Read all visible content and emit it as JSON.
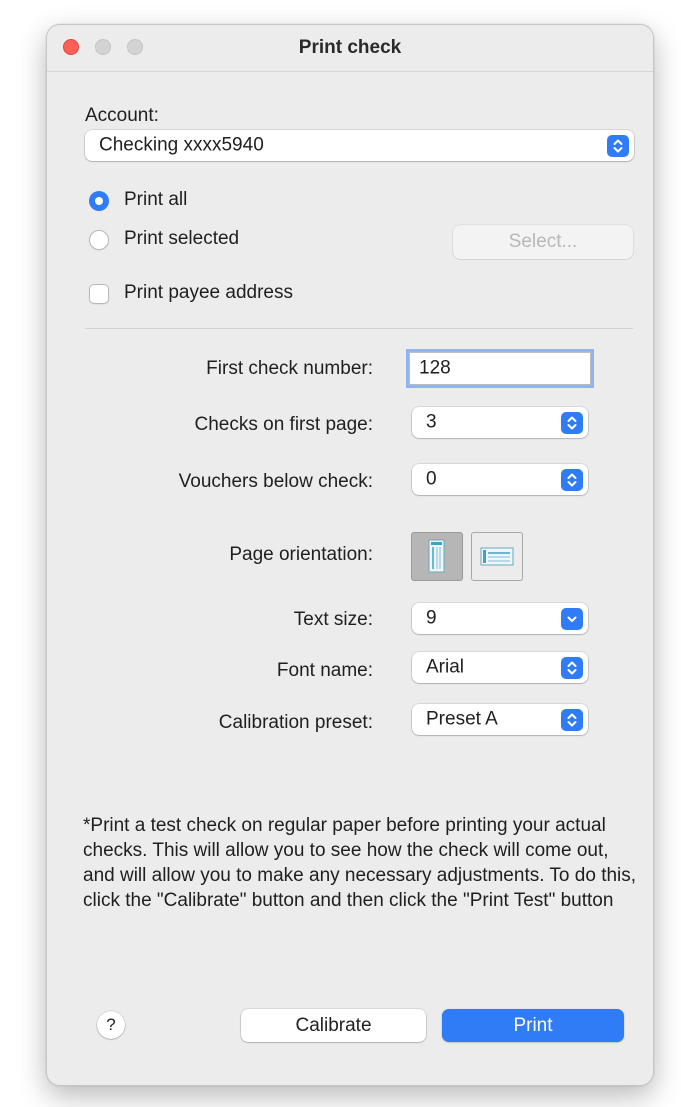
{
  "window": {
    "title": "Print check"
  },
  "account": {
    "label": "Account:",
    "selected": "Checking xxxx5940"
  },
  "print_options": {
    "print_all": "Print all",
    "print_selected": "Print selected",
    "select_button": "Select...",
    "print_payee_address": "Print payee address",
    "selected_option": "print_all"
  },
  "fields": {
    "first_check_number_label": "First check number:",
    "first_check_number": "128",
    "checks_on_first_page_label": "Checks on first page:",
    "checks_on_first_page": "3",
    "vouchers_below_check_label": "Vouchers below check:",
    "vouchers_below_check": "0",
    "page_orientation_label": "Page orientation:",
    "text_size_label": "Text size:",
    "text_size": "9",
    "font_name_label": "Font name:",
    "font_name": "Arial",
    "calibration_preset_label": "Calibration preset:",
    "calibration_preset": "Preset A"
  },
  "note": "*Print a test check on regular paper before printing your actual checks. This will allow you to see how the check will come out, and will allow you to make any necessary adjustments. To do this, click the \"Calibrate\" button and then click the \"Print Test\" button",
  "buttons": {
    "help": "?",
    "calibrate": "Calibrate",
    "print": "Print"
  },
  "colors": {
    "accent": "#2f7cf6",
    "window_bg": "#ececec",
    "close_red": "#fe5f57"
  }
}
